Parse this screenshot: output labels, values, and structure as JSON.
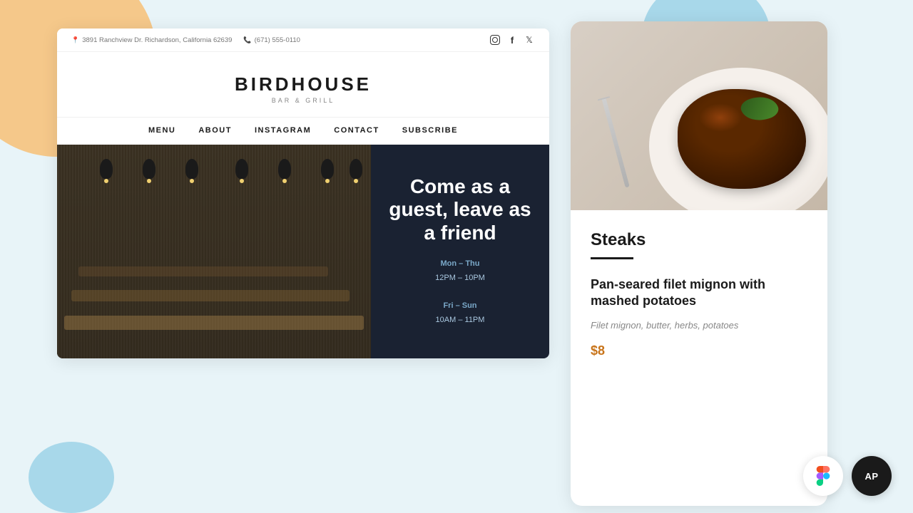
{
  "background": {
    "color": "#ddeef5"
  },
  "website": {
    "topbar": {
      "address": "3891 Ranchview Dr. Richardson, California 62639",
      "phone": "(671) 555-0110",
      "address_icon": "pin-icon",
      "phone_icon": "phone-icon"
    },
    "logo": {
      "name": "BIRDHOUSE",
      "tagline": "BAR & GRILL"
    },
    "nav": {
      "items": [
        "MENU",
        "ABOUT",
        "INSTAGRAM",
        "CONTACT",
        "SUBSCRIBE"
      ]
    },
    "hero": {
      "title": "Come as a guest, leave as a friend",
      "hours": [
        {
          "days": "Mon – Thu",
          "time": "12PM – 10PM"
        },
        {
          "days": "Fri – Sun",
          "time": "10AM – 11PM"
        }
      ]
    }
  },
  "food_card": {
    "category": "Steaks",
    "item_name": "Pan-seared filet mignon with mashed potatoes",
    "description": "Filet mignon, butter, herbs, potatoes",
    "price": "$8"
  },
  "buttons": {
    "figma_label": "Figma",
    "ap_label": "AP"
  }
}
